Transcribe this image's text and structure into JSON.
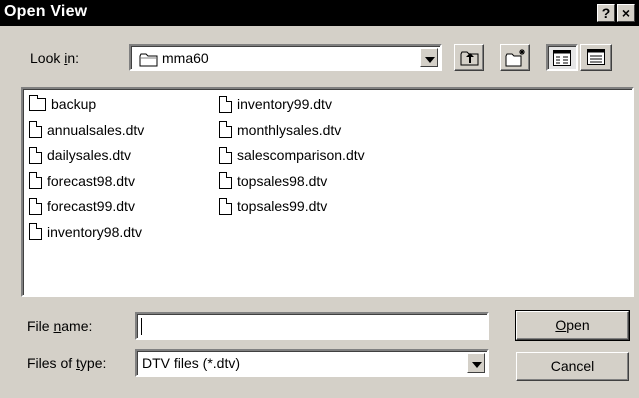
{
  "window": {
    "title": "Open View",
    "help_label": "?",
    "close_label": "×"
  },
  "look_in": {
    "label_pre": "Look ",
    "label_key": "i",
    "label_post": "n:",
    "value": "mma60"
  },
  "files": [
    {
      "name": "backup",
      "type": "folder"
    },
    {
      "name": "annualsales.dtv",
      "type": "file"
    },
    {
      "name": "dailysales.dtv",
      "type": "file"
    },
    {
      "name": "forecast98.dtv",
      "type": "file"
    },
    {
      "name": "forecast99.dtv",
      "type": "file"
    },
    {
      "name": "inventory98.dtv",
      "type": "file"
    },
    {
      "name": "inventory99.dtv",
      "type": "file"
    },
    {
      "name": "monthlysales.dtv",
      "type": "file"
    },
    {
      "name": "salescomparison.dtv",
      "type": "file"
    },
    {
      "name": "topsales98.dtv",
      "type": "file"
    },
    {
      "name": "topsales99.dtv",
      "type": "file"
    }
  ],
  "file_name": {
    "label_pre": "File ",
    "label_key": "n",
    "label_post": "ame:",
    "value": ""
  },
  "file_type": {
    "label_pre": "Files of ",
    "label_key": "t",
    "label_post": "ype:",
    "value": "DTV files (*.dtv)"
  },
  "buttons": {
    "open_key": "O",
    "open_rest": "pen",
    "cancel": "Cancel"
  }
}
